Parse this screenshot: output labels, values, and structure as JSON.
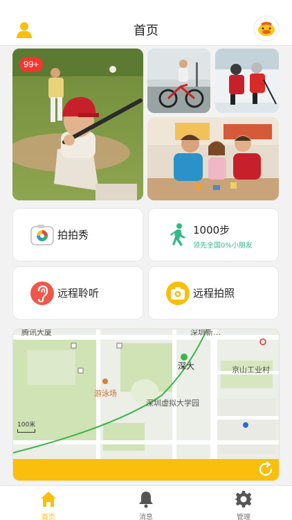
{
  "header": {
    "title": "首页"
  },
  "photos": {
    "badge": "99+"
  },
  "cards": {
    "photo_show": "拍拍秀",
    "steps": "1000步",
    "steps_sub": "领先全国0%小朋友",
    "remote_listen": "远程聆听",
    "remote_photo": "远程拍照"
  },
  "map": {
    "labels": {
      "tencent": "腾讯大厦",
      "shenzhen_univ": "深大",
      "jingshan": "京山工业村",
      "pool": "游泳场",
      "virtual_univ": "深圳虚拟大学园",
      "shenzhen_new": "深圳新…"
    },
    "scale": "100米"
  },
  "tabs": [
    {
      "label": "首页"
    },
    {
      "label": "消息"
    },
    {
      "label": "管理"
    }
  ],
  "colors": {
    "accent": "#f9bf0c",
    "badge": "#f0372f",
    "step_green": "#34b889"
  }
}
